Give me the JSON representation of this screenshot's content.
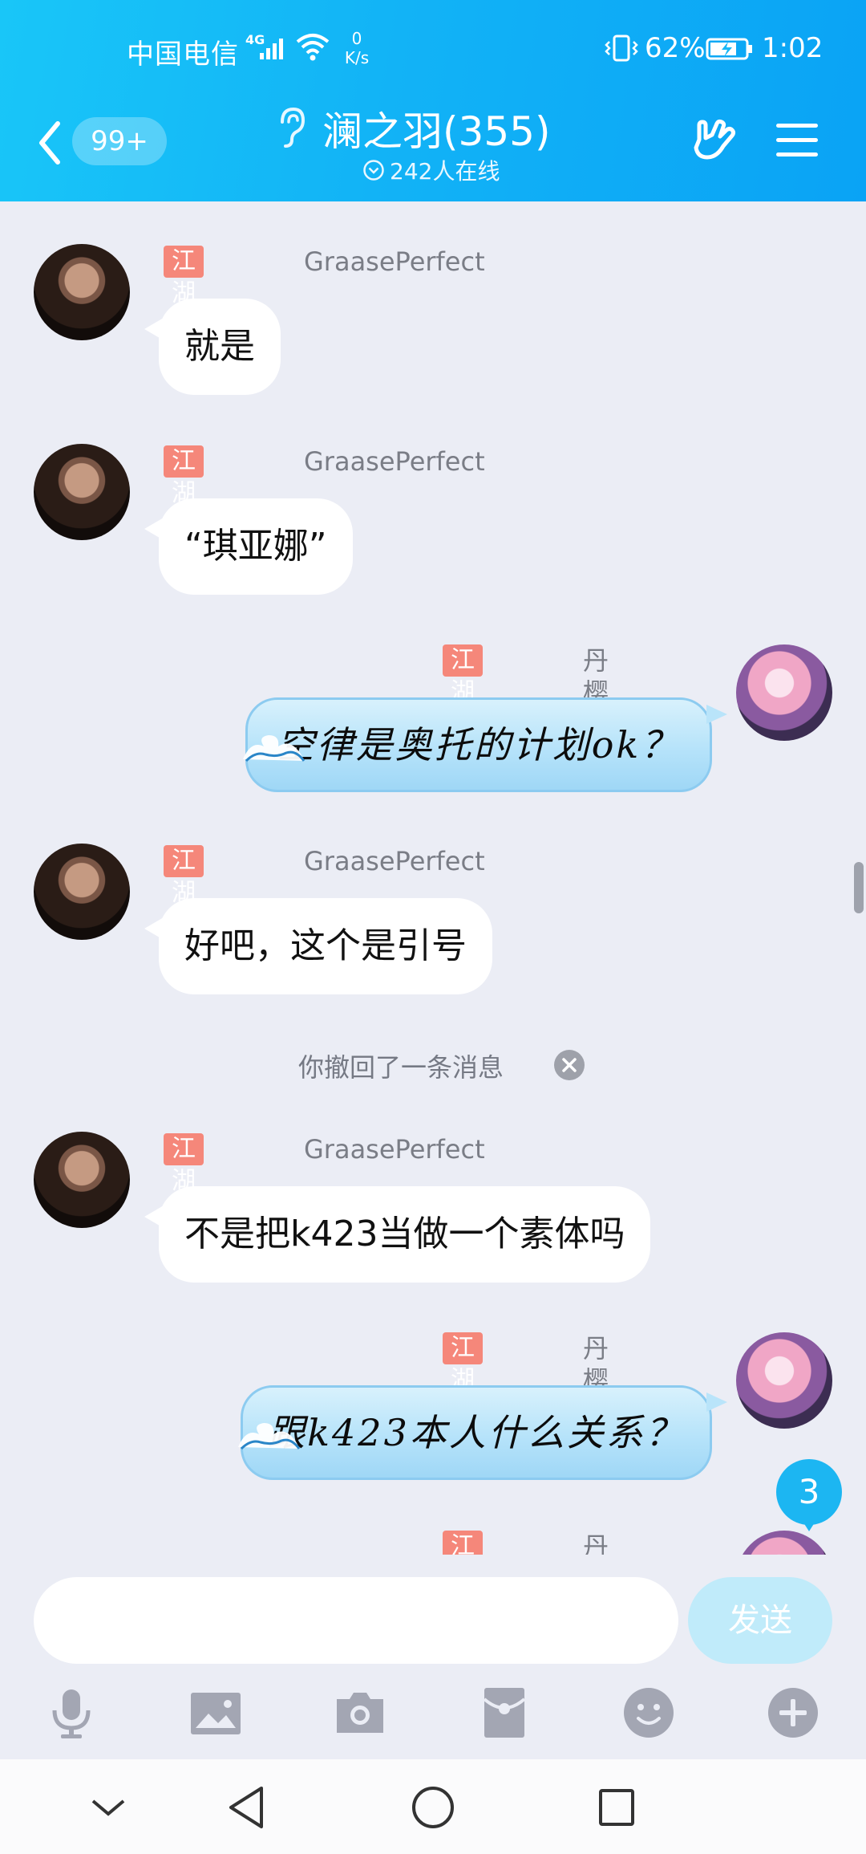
{
  "status_bar": {
    "carrier": "中国电信",
    "network_type": "4G",
    "net_speed_value": "0",
    "net_speed_unit": "K/s",
    "battery_percent": "62%",
    "time": "1:02",
    "icons": [
      "signal-icon",
      "wifi-icon",
      "vibrate-icon",
      "battery-charging-icon"
    ]
  },
  "header": {
    "unread_count": "99+",
    "title": "澜之羽(355)",
    "online": "242人在线",
    "icons": [
      "back-icon",
      "ear-icon",
      "gesture-icon",
      "menu-icon"
    ]
  },
  "messages": [
    {
      "side": "left",
      "tag": "江湖传说",
      "sender": "GraasePerfect",
      "text": "就是"
    },
    {
      "side": "left",
      "tag": "江湖传说",
      "sender": "GraasePerfect",
      "text": "“琪亚娜”"
    },
    {
      "side": "right",
      "tag": "江湖传说",
      "sender": "丹樱喵 ~",
      "text": "空律是奥托的计划ok？"
    },
    {
      "side": "left",
      "tag": "江湖传说",
      "sender": "GraasePerfect",
      "text": "好吧，这个是引号"
    },
    {
      "side": "left",
      "tag": "江湖传说",
      "sender": "GraasePerfect",
      "text": "不是把k423当做一个素体吗"
    },
    {
      "side": "right",
      "tag": "江湖传说",
      "sender": "丹樱喵 ~",
      "text": "跟k423本人什么关系？"
    },
    {
      "side": "right",
      "tag": "江湖传说",
      "sender": "丹樱喵 ~",
      "text": ""
    }
  ],
  "recall_notice": "你撤回了一条消息",
  "new_message_count": "3",
  "input": {
    "placeholder": "",
    "value": "",
    "send_label": "发送"
  },
  "toolbar": [
    "microphone-icon",
    "image-icon",
    "camera-icon",
    "red-packet-icon",
    "emoji-icon",
    "plus-icon"
  ],
  "nav_bar": [
    "collapse-icon",
    "back-triangle-icon",
    "home-circle-icon",
    "recents-square-icon"
  ],
  "colors": {
    "header_gradient_start": "#19c6f8",
    "header_gradient_end": "#0aa3f5",
    "background": "#ebedf5",
    "tag_bg": "#f5877a",
    "send_button": "#c0ebfa",
    "new_badge": "#1cb6f2"
  }
}
